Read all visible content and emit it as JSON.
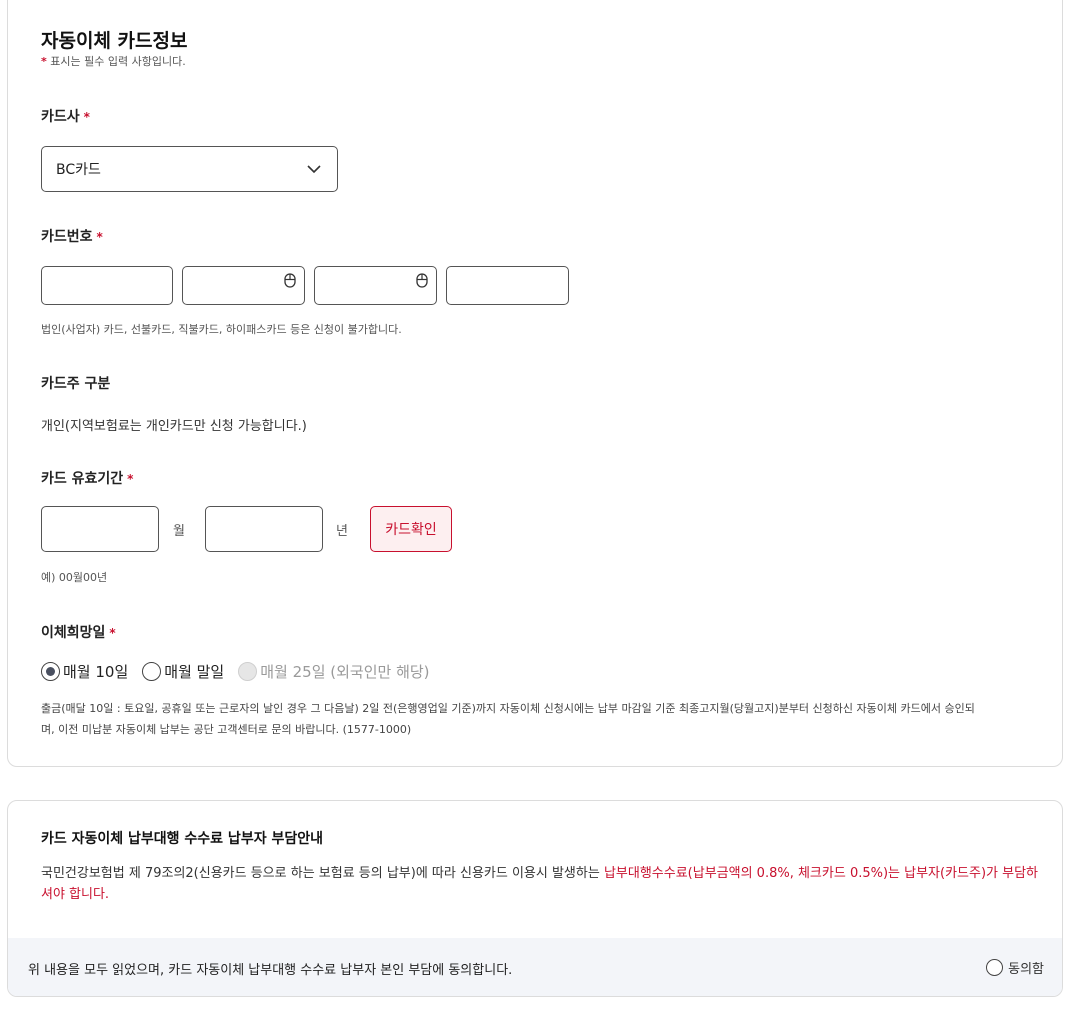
{
  "form": {
    "title": "자동이체 카드정보",
    "required_mark": "*",
    "required_note": "표시는 필수 입력 사항입니다.",
    "card_company": {
      "label": "카드사",
      "selected": "BC카드"
    },
    "card_number": {
      "label": "카드번호",
      "help": "법인(사업자) 카드, 선불카드, 직불카드, 하이패스카드 등은 신청이 불가합니다."
    },
    "card_owner": {
      "label": "카드주 구분",
      "value": "개인(지역보험료는 개인카드만 신청 가능합니다.)"
    },
    "expiry": {
      "label": "카드 유효기간",
      "month_unit": "월",
      "year_unit": "년",
      "confirm_button": "카드확인",
      "help": "예) 00월00년"
    },
    "transfer_day": {
      "label": "이체희망일",
      "options": [
        {
          "label": "매월 10일",
          "checked": true,
          "disabled": false
        },
        {
          "label": "매월 말일",
          "checked": false,
          "disabled": false
        },
        {
          "label": "매월 25일 (외국인만 해당)",
          "checked": false,
          "disabled": true
        }
      ],
      "help_line1": "출금(매달 10일 : 토요일, 공휴일 또는 근로자의 날인 경우 그 다음날) 2일 전(은행영업일 기준)까지 자동이체 신청시에는 납부 마감일 기준 최종고지월(당월고지)분부터 신청하신 자동이체 카드에서 승인되",
      "help_line2": "며, 이전 미납분 자동이체 납부는 공단 고객센터로 문의 바랍니다. (1577-1000)"
    }
  },
  "notice": {
    "title": "카드 자동이체 납부대행 수수료 납부자 부담안내",
    "text_normal": "국민건강보험법 제 79조의2(신용카드 등으로 하는 보험료 등의 납부)에 따라 신용카드 이용시 발생하는 ",
    "text_red": "납부대행수수료(납부금액의 0.8%, 체크카드 0.5%)는 납부자(카드주)가 부담하셔야 합니다.",
    "agree_text": "위 내용을 모두 읽었으며, 카드 자동이체 납부대행 수수료 납부자 본인 부담에 동의합니다.",
    "agree_label": "동의함"
  },
  "colors": {
    "accent_red": "#c8102e",
    "confirm_bg": "#fdeff0",
    "agree_bar_bg": "#f3f5f9"
  }
}
